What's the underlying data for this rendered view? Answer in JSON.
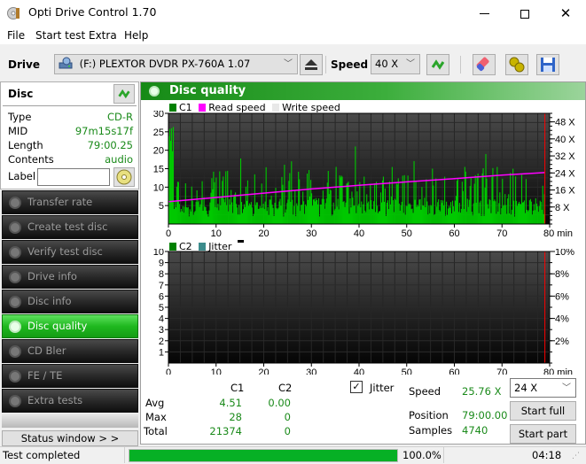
{
  "window": {
    "title": "Opti Drive Control 1.70",
    "minimize": "—",
    "maximize": "☐",
    "close": "✕"
  },
  "menu": [
    "File",
    "Start test",
    "Extra",
    "Help"
  ],
  "toolbar": {
    "drive_label": "Drive",
    "drive_value": "(F:)  PLEXTOR DVDR   PX-760A 1.07",
    "speed_label": "Speed",
    "speed_value": "40 X",
    "icons": [
      "drive-icon",
      "eject-icon",
      "refresh-icon",
      "eraser-icon",
      "settings-icon",
      "save-icon"
    ]
  },
  "disc": {
    "title": "Disc",
    "rows": [
      {
        "label": "Type",
        "value": "CD-R"
      },
      {
        "label": "MID",
        "value": "97m15s17f"
      },
      {
        "label": "Length",
        "value": "79:00.25"
      },
      {
        "label": "Contents",
        "value": "audio"
      }
    ],
    "label_field_label": "Label",
    "label_field_value": ""
  },
  "nav": [
    {
      "label": "Transfer rate",
      "active": false
    },
    {
      "label": "Create test disc",
      "active": false
    },
    {
      "label": "Verify test disc",
      "active": false
    },
    {
      "label": "Drive info",
      "active": false
    },
    {
      "label": "Disc info",
      "active": false
    },
    {
      "label": "Disc quality",
      "active": true
    },
    {
      "label": "CD Bler",
      "active": false
    },
    {
      "label": "FE / TE",
      "active": false
    },
    {
      "label": "Extra tests",
      "active": false
    }
  ],
  "status_window_button": "Status window > >",
  "panel_title": "Disc quality",
  "colors": {
    "c1": "#00c800",
    "read_speed": "#ff00ff",
    "write_speed": "#e8e8e8",
    "c2": "#008000",
    "jitter": "#3c8c8c",
    "end_marker": "#ff0000",
    "accent": "#1fb81f"
  },
  "chart_data": [
    {
      "type": "bar",
      "title": "C1 / Read speed",
      "legend": [
        "C1",
        "Read speed",
        "Write speed"
      ],
      "legend_position": "top-left",
      "xlabel": "min",
      "x_ticks": [
        "0",
        "10",
        "20",
        "30",
        "40",
        "50",
        "60",
        "70",
        "80 min"
      ],
      "xlim": [
        0,
        80
      ],
      "y_ticks": [
        "5",
        "10",
        "15",
        "20",
        "25",
        "30"
      ],
      "ylim": [
        0,
        30
      ],
      "y2_ticks": [
        "8 X",
        "16 X",
        "24 X",
        "32 X",
        "40 X",
        "48 X"
      ],
      "y2lim": [
        0,
        52
      ],
      "grid": true,
      "series": [
        {
          "name": "C1",
          "type": "bar",
          "summary": {
            "avg": 4.51,
            "max": 28,
            "total": 21374
          }
        },
        {
          "name": "Read speed",
          "type": "line",
          "x": [
            0,
            10,
            20,
            30,
            40,
            50,
            60,
            70,
            79
          ],
          "values": [
            10.5,
            12.5,
            14.5,
            16.5,
            18.2,
            19.8,
            21.3,
            23.0,
            24.2
          ]
        }
      ],
      "end_marker_min": 79
    },
    {
      "type": "bar",
      "title": "C2 / Jitter",
      "legend": [
        "C2",
        "Jitter"
      ],
      "legend_position": "top-left",
      "xlabel": "min",
      "x_ticks": [
        "0",
        "10",
        "20",
        "30",
        "40",
        "50",
        "60",
        "70",
        "80 min"
      ],
      "xlim": [
        0,
        80
      ],
      "y_ticks": [
        "1",
        "2",
        "3",
        "4",
        "5",
        "6",
        "7",
        "8",
        "9",
        "10"
      ],
      "ylim": [
        0,
        10
      ],
      "y2_ticks": [
        "2%",
        "4%",
        "6%",
        "8%",
        "10%"
      ],
      "y2lim": [
        0,
        10
      ],
      "grid": true,
      "series": [
        {
          "name": "C2",
          "type": "bar",
          "summary": {
            "avg": 0.0,
            "max": 0,
            "total": 0
          }
        }
      ],
      "end_marker_min": 79
    }
  ],
  "stats": {
    "col_headers": [
      "C1",
      "C2"
    ],
    "rows": [
      {
        "label": "Avg",
        "c1": "4.51",
        "c2": "0.00"
      },
      {
        "label": "Max",
        "c1": "28",
        "c2": "0"
      },
      {
        "label": "Total",
        "c1": "21374",
        "c2": "0"
      }
    ],
    "jitter_label": "Jitter",
    "jitter_checked": true,
    "speed_label": "Speed",
    "speed_value": "25.76 X",
    "position_label": "Position",
    "position_value": "79:00.00",
    "samples_label": "Samples",
    "samples_value": "4740",
    "test_speed": "24 X",
    "start_full": "Start full",
    "start_part": "Start part"
  },
  "statusbar": {
    "text": "Test completed",
    "progress_percent": 100,
    "progress_text": "100.0%",
    "time": "04:18"
  }
}
